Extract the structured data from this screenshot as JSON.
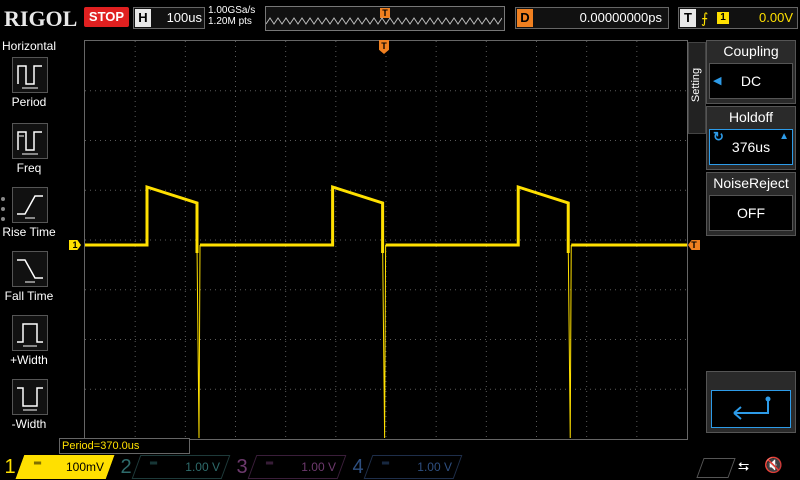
{
  "app": {
    "brand": "RIGOL"
  },
  "toolbar": {
    "run_state": "STOP",
    "horizontal": {
      "label": "H",
      "value": "100us"
    },
    "sample_rate": "1.00GSa/s",
    "memory_depth": "1.20M pts",
    "trigger_pos_marker": "T",
    "delay": {
      "label": "D",
      "value": "0.00000000ps"
    },
    "trigger": {
      "label": "T",
      "edge_icon": "rising-edge-icon",
      "source": "1",
      "level": "0.00V"
    }
  },
  "left_menu": {
    "title": "Horizontal",
    "items": [
      {
        "label": "Period",
        "icon": "period-icon"
      },
      {
        "label": "Freq",
        "icon": "frequency-icon"
      },
      {
        "label": "Rise Time",
        "icon": "rise-time-icon"
      },
      {
        "label": "Fall Time",
        "icon": "fall-time-icon"
      },
      {
        "label": "+Width",
        "icon": "positive-width-icon"
      },
      {
        "label": "-Width",
        "icon": "negative-width-icon"
      }
    ]
  },
  "right_menu": {
    "tab_label": "Setting",
    "items": [
      {
        "header": "Coupling",
        "value": "DC"
      },
      {
        "header": "Holdoff",
        "value": "376us"
      },
      {
        "header": "NoiseReject",
        "value": "OFF"
      }
    ],
    "enter_icon": "enter-icon"
  },
  "measurement": {
    "text": "Period=370.0us"
  },
  "waveform": {
    "color": "#ffe000",
    "channel_marker": "1",
    "trigger_level_marker": "T",
    "period_us": 370.0,
    "timebase_us_per_div": 100,
    "volts_per_div_mV": 100
  },
  "channels": [
    {
      "num": "1",
      "scale": "100mV",
      "color": "#ffe000",
      "active": true
    },
    {
      "num": "2",
      "scale": "1.00 V",
      "color": "#2e6b6b",
      "active": false
    },
    {
      "num": "3",
      "scale": "1.00 V",
      "color": "#6e3a6e",
      "active": false
    },
    {
      "num": "4",
      "scale": "1.00 V",
      "color": "#2e4f80",
      "active": false
    }
  ],
  "status_icons": {
    "usb": "usb-icon",
    "speaker": "speaker-muted-icon"
  }
}
